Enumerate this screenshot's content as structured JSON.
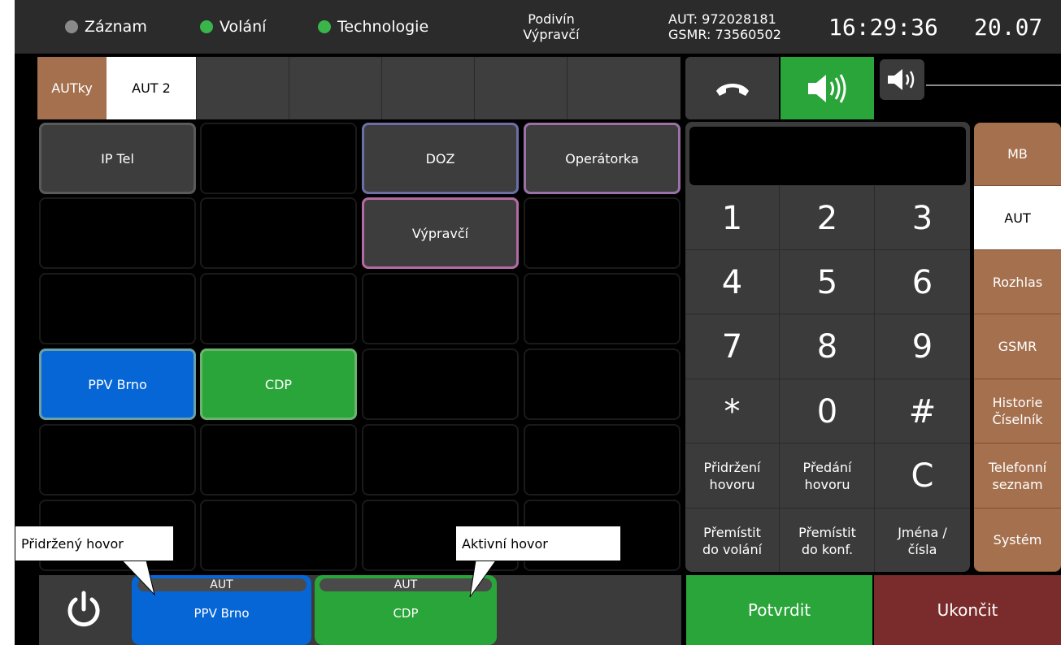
{
  "status": {
    "items": [
      {
        "label": "Záznam",
        "state_color": "#8a8a8a"
      },
      {
        "label": "Volání",
        "state_color": "#39b54a"
      },
      {
        "label": "Technologie",
        "state_color": "#39b54a"
      }
    ],
    "station": "Podivín",
    "role": "Výpravčí",
    "aut_number": "AUT: 972028181",
    "gsmr_number": "GSMR: 73560502",
    "time": "16:29:36",
    "date": "20.07"
  },
  "aut_tabs": {
    "group_label": "AUTky",
    "active_tab": "AUT 2"
  },
  "audio": {
    "hangup_icon": "handset-down-icon",
    "speaker_icon": "speaker-on-icon",
    "volume_icon": "volume-icon",
    "volume_level": 0.05
  },
  "grid": {
    "buttons": {
      "ip_tel": "IP Tel",
      "doz": "DOZ",
      "operatorka": "Operátorka",
      "vypravci": "Výpravčí",
      "ppv_brno": "PPV Brno",
      "cdp": "CDP"
    }
  },
  "keypad": {
    "display": "",
    "digits": [
      "1",
      "2",
      "3",
      "4",
      "5",
      "6",
      "7",
      "8",
      "9",
      "*",
      "0",
      "#"
    ],
    "hold_line1": "Přidržení",
    "hold_line2": "hovoru",
    "transfer_line1": "Předání",
    "transfer_line2": "hovoru",
    "clear": "C",
    "move_call_line1": "Přemístit",
    "move_call_line2": "do volání",
    "move_conf_line1": "Přemístit",
    "move_conf_line2": "do konf.",
    "names_line1": "Jména /",
    "names_line2": "čísla"
  },
  "side_menu": {
    "mb": "MB",
    "aut": "AUT",
    "rozhlas": "Rozhlas",
    "gsmr": "GSMR",
    "historie1": "Historie",
    "historie2": "Číselník",
    "telefonni1": "Telefonní",
    "telefonni2": "seznam",
    "system": "Systém"
  },
  "calls": {
    "held": {
      "tag": "AUT",
      "name": "PPV Brno",
      "color": "#0766d6"
    },
    "active": {
      "tag": "AUT",
      "name": "CDP",
      "color": "#2aa53a"
    }
  },
  "actions": {
    "confirm": "Potvrdit",
    "end": "Ukončit"
  },
  "annotations": {
    "held_call": "Přidržený hovor",
    "active_call": "Aktivní hovor"
  }
}
